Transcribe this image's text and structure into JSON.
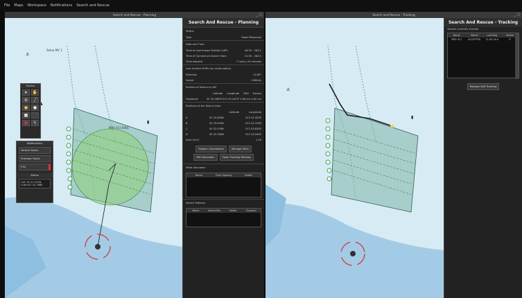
{
  "menu": [
    "File",
    "Maps",
    "Workspace",
    "Notifications",
    "Search and Rescue"
  ],
  "planning_window": {
    "title": "Search and Rescue - Planning",
    "header": "Search And Rescue - Planning",
    "status_label": "Status",
    "type_label": "Type",
    "type_value": "Rapid Response",
    "date_time_label": "Date and Time",
    "lkp_label": "Time of Last Known Position (LKP)",
    "lkp_value": "16:50 - 28/11",
    "css_label": "Time of Commence Search Start",
    "css_value": "21:00 - 28/11",
    "elapsed_label": "Time elapsed",
    "elapsed_value": "7 hours, 25 minutes",
    "drift_label": "Last Surface Drifts (on continuation)",
    "direction_label": "Direction",
    "direction_value": "13.80°",
    "speed_label": "Speed",
    "speed_value": "0.88m/s",
    "datum_label": "Position of Datum to LKP",
    "datum_cols": [
      "Latitude",
      "Longitude",
      "RDV",
      "Radius"
    ],
    "displ_label": "Displaced",
    "displ_value": "55 33.288'N  012 43.149'E  1.68 nm  4.82 nm",
    "corners_label": "Positions of the Search Area",
    "corner_cols": [
      "",
      "Latitude",
      "Longitude"
    ],
    "corners": [
      [
        "A",
        "55 33.628N",
        "012 42.424E"
      ],
      [
        "B",
        "55 33.678N",
        "012 42.378E"
      ],
      [
        "C",
        "55 32.578N",
        "012 43.834E"
      ],
      [
        "D",
        "55 32.908N",
        "012 43.040E"
      ]
    ],
    "area_label": "Area (nm²)",
    "area_value": "1.16",
    "buttons": [
      "Reopen Calculations",
      "Manage SRUs",
      "SRU Allocation",
      "Open Tracking Window"
    ],
    "effort_label": "Effort Allocation",
    "effort_cols": [
      "Name",
      "Track Spacing",
      "Visible"
    ],
    "patterns_label": "Search Patterns",
    "pattern_cols": [
      "Name",
      "Search/Srv",
      "Visible",
      "Dynamic"
    ]
  },
  "tracking_window": {
    "title": "Search and Rescue - Tracking",
    "header": "Search And Rescue - Tracking",
    "vessels_label": "Vessels currently tracked",
    "cols": [
      "Name",
      "Status",
      "Last Msg",
      "Visible"
    ],
    "row": [
      "MRV 411",
      "ACCEPTED",
      "11:28 16:0",
      ""
    ],
    "manage_button": "Manage SAR Tracking"
  },
  "toolbar": {
    "label": "Toolbar"
  },
  "notifications": {
    "label": "Notifications",
    "items": [
      "Tactical Route",
      "Strategic Route",
      "PTD"
    ]
  },
  "status": {
    "label": "Status",
    "lines": [
      "LAT: 55 21.919N",
      "LON:012 42.766E"
    ]
  },
  "map_labels": {
    "sru1": "Sama MV 1",
    "sru2": "MRV 411 0001"
  },
  "colors": {
    "search_area": "#7fb7a7",
    "circle": "#8fcf7f",
    "route": "#1a1a1a",
    "track": "#2f7f4f"
  }
}
